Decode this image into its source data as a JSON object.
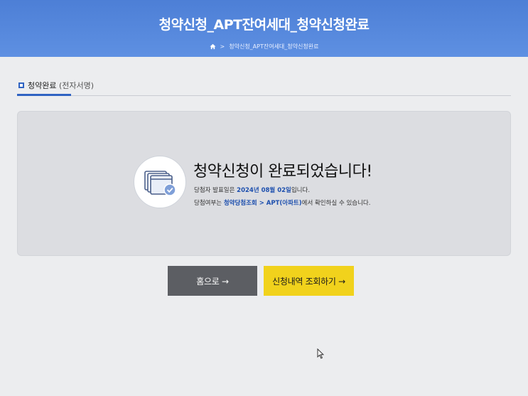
{
  "header": {
    "title": "청약신청_APT잔여세대_청약신청완료",
    "breadcrumb": {
      "home_icon": "home-icon",
      "separator": ">",
      "current": "청약신청_APT잔여세대_청약신청완료"
    }
  },
  "section": {
    "title": "청약완료",
    "subtitle": "(전자서명)"
  },
  "panel": {
    "icon": "document-check-icon",
    "title": "청약신청이 완료되었습니다!",
    "line1": {
      "prefix": "당첨자 발표일은 ",
      "date": "2024년 08월 02일",
      "suffix": "입니다."
    },
    "line2": {
      "prefix": "당첨여부는 ",
      "path": "청약당첨조회 > APT(아파트)",
      "suffix": "에서 확인하실 수 있습니다."
    }
  },
  "buttons": {
    "home": "홈으로 →",
    "lookup": "신청내역 조회하기 →"
  },
  "colors": {
    "header": "#5e90e2",
    "accent": "#2f63c2",
    "home_button": "#5c5e63",
    "lookup_button": "#f1d21c"
  }
}
